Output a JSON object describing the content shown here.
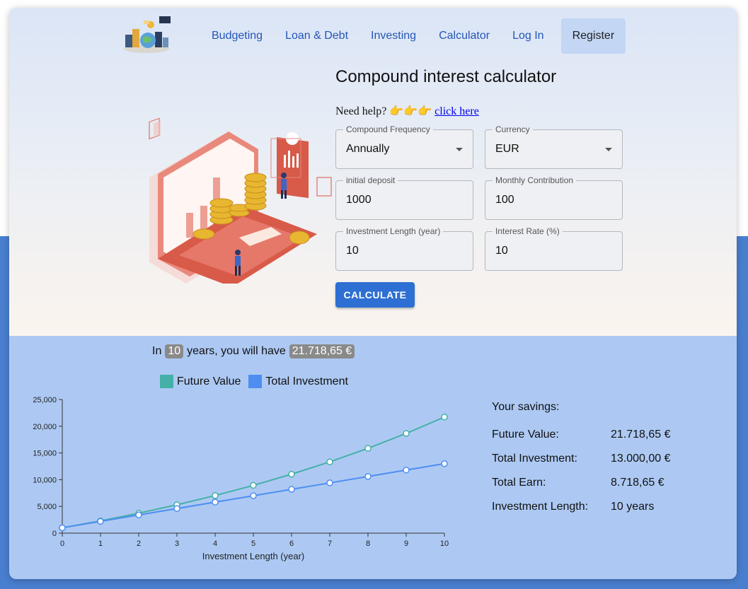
{
  "nav": {
    "items": [
      "Budgeting",
      "Loan & Debt",
      "Investing",
      "Calculator",
      "Log In"
    ],
    "register": "Register"
  },
  "form": {
    "title": "Compound interest calculator",
    "help_prefix": "Need help? 👉👉👉",
    "help_link": "click here",
    "compound_frequency": {
      "label": "Compound Frequency",
      "value": "Annually"
    },
    "currency": {
      "label": "Currency",
      "value": "EUR"
    },
    "initial_deposit": {
      "label": "initial deposit",
      "value": "1000"
    },
    "monthly_contribution": {
      "label": "Monthly Contribution",
      "value": "100"
    },
    "investment_length": {
      "label": "Investment Length (year)",
      "value": "10"
    },
    "interest_rate": {
      "label": "Interest Rate (%)",
      "value": "10"
    },
    "calculate": "CALCULATE"
  },
  "result": {
    "prefix": "In",
    "years": "10",
    "middle": "years, you will have",
    "amount": "21.718,65 €"
  },
  "savings": {
    "title": "Your savings:",
    "rows": [
      {
        "key": "Future Value:",
        "value": "21.718,65 €"
      },
      {
        "key": "Total Investment:",
        "value": "13.000,00 €"
      },
      {
        "key": "Total Earn:",
        "value": "8.718,65 €"
      },
      {
        "key": "Investment Length:",
        "value": "10 years"
      }
    ]
  },
  "chart_data": {
    "type": "line",
    "x": [
      0,
      1,
      2,
      3,
      4,
      5,
      6,
      7,
      8,
      9,
      10
    ],
    "xlabel": "Investment Length (year)",
    "ylabel": "",
    "ylim": [
      0,
      25000
    ],
    "yticks": [
      "0",
      "5,000",
      "10,000",
      "15,000",
      "20,000",
      "25,000"
    ],
    "yticks_values": [
      0,
      5000,
      10000,
      15000,
      20000,
      25000
    ],
    "legend": "top",
    "series": [
      {
        "name": "Future Value",
        "color": "#45b0a8",
        "values": [
          1000,
          2300,
          3730,
          5303,
          7033,
          8937,
          11030,
          13333,
          15867,
          18653,
          21719
        ]
      },
      {
        "name": "Total Investment",
        "color": "#4d8ef0",
        "values": [
          1000,
          2200,
          3400,
          4600,
          5800,
          7000,
          8200,
          9400,
          10600,
          11800,
          13000
        ]
      }
    ]
  }
}
